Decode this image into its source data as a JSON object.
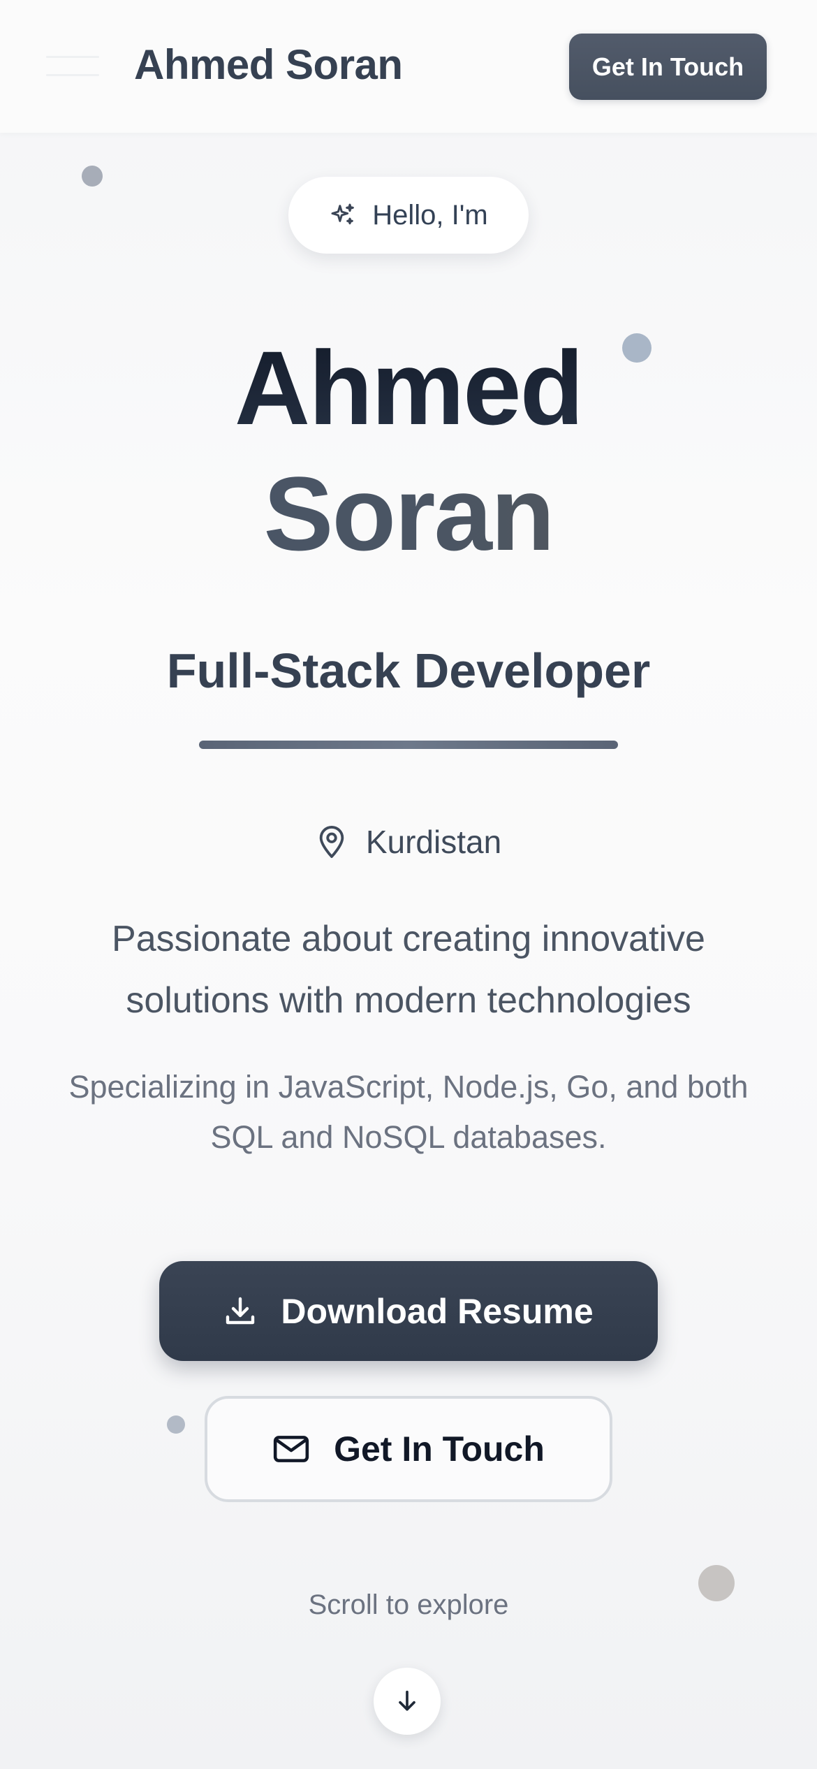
{
  "header": {
    "brand": "Ahmed Soran",
    "cta_label": "Get In Touch"
  },
  "hero": {
    "greeting": "Hello, I'm",
    "first_name": "Ahmed",
    "last_name": "Soran",
    "role": "Full-Stack Developer",
    "location": "Kurdistan",
    "tagline": "Passionate about creating innovative solutions with modern technologies",
    "skills": "Specializing in JavaScript, Node.js, Go, and both SQL and NoSQL databases.",
    "download_label": "Download Resume",
    "contact_label": "Get In Touch",
    "scroll_label": "Scroll to explore"
  },
  "icons": {
    "menu": "menu-icon",
    "greeting": "sparkles-icon",
    "location": "map-pin-icon",
    "download": "download-icon",
    "contact": "mail-icon",
    "scroll": "arrow-down-icon"
  },
  "colors": {
    "primary_dark": "#303a4a",
    "header_button": "#4b5563",
    "text": "#334155",
    "muted": "#6b7280"
  }
}
